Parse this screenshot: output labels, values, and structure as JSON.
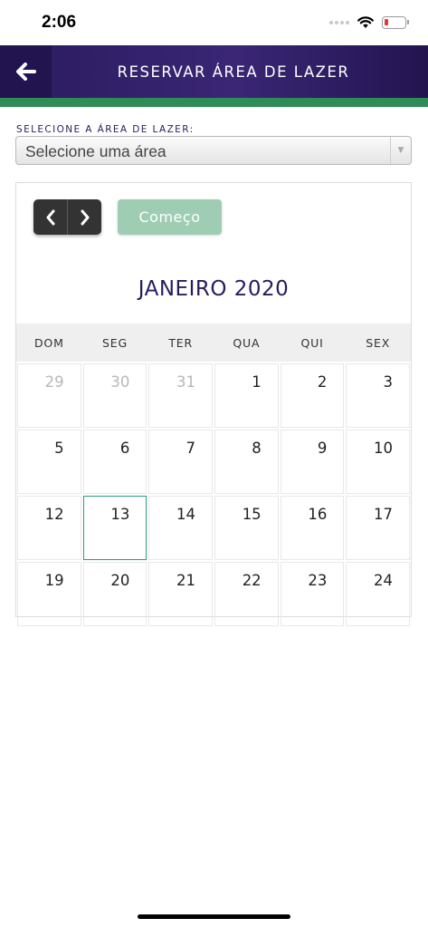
{
  "status_bar": {
    "time": "2:06"
  },
  "header": {
    "title": "RESERVAR ÁREA DE LAZER"
  },
  "area": {
    "label": "SELECIONE A ÁREA DE LAZER:",
    "selected": "Selecione uma área"
  },
  "calendar": {
    "start_label": "Começo",
    "month_title": "JANEIRO 2020",
    "weekdays": [
      "DOM",
      "SEG",
      "TER",
      "QUA",
      "QUI",
      "SEX"
    ],
    "weeks": [
      [
        "29",
        "30",
        "31",
        "1",
        "2",
        "3"
      ],
      [
        "5",
        "6",
        "7",
        "8",
        "9",
        "10"
      ],
      [
        "12",
        "13",
        "14",
        "15",
        "16",
        "17"
      ],
      [
        "19",
        "20",
        "21",
        "22",
        "23",
        "24"
      ]
    ],
    "today": "13",
    "colors": {
      "accent": "#2a1b5e",
      "stripe": "#2e8c57",
      "today_border": "#2e9a80"
    }
  }
}
